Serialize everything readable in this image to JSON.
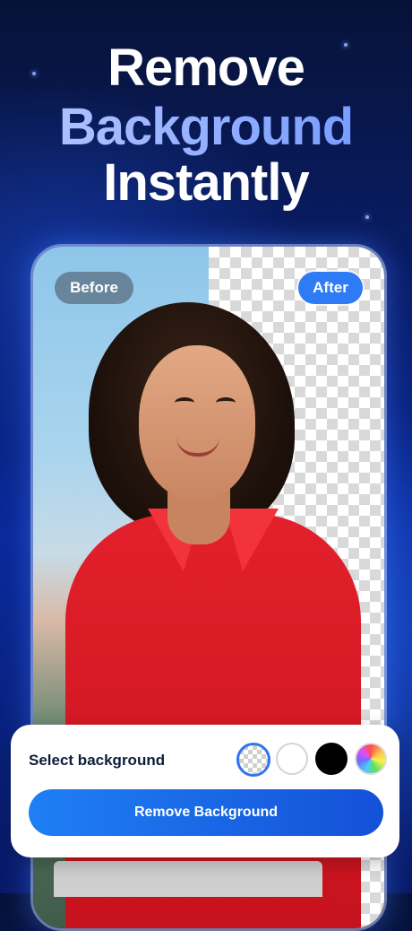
{
  "headline": {
    "line1": "Remove",
    "line2": "Background",
    "line3": "Instantly"
  },
  "preview": {
    "before_label": "Before",
    "after_label": "After"
  },
  "background_selector": {
    "label": "Select background",
    "options": [
      "transparent",
      "white",
      "black",
      "color-picker"
    ],
    "selected": "transparent"
  },
  "cta": {
    "label": "Remove Background"
  },
  "colors": {
    "accent": "#2f7bf5",
    "shirt": "#e3202b"
  }
}
